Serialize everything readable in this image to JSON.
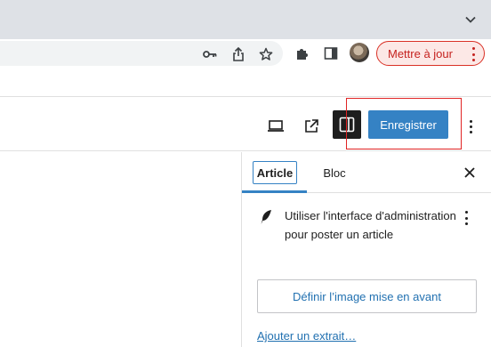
{
  "browser": {
    "tabstrip": {
      "tab_list_icon": "chevron-down-icon"
    },
    "toolbar": {
      "icons": [
        "key-icon",
        "share-icon",
        "star-icon",
        "extensions-icon",
        "side-panel-icon"
      ],
      "update_button_label": "Mettre à jour"
    }
  },
  "editor_header": {
    "icons": [
      "preview-device-icon",
      "external-link-icon",
      "settings-sidebar-icon",
      "more-options-icon"
    ],
    "save_label": "Enregistrer"
  },
  "sidebar": {
    "tabs": [
      {
        "label": "Article",
        "active": true
      },
      {
        "label": "Bloc",
        "active": false
      }
    ],
    "close_icon": "close-icon",
    "notice": {
      "icon": "feather-icon",
      "text": "Utiliser l'interface d'administration pour poster un article"
    },
    "featured_image_label": "Définir l’image mise en avant",
    "excerpt_link": "Ajouter un extrait…"
  },
  "colors": {
    "accent": "#3582c4",
    "link": "#2271b1",
    "update_border": "#d93025",
    "highlight": "#e02424"
  }
}
